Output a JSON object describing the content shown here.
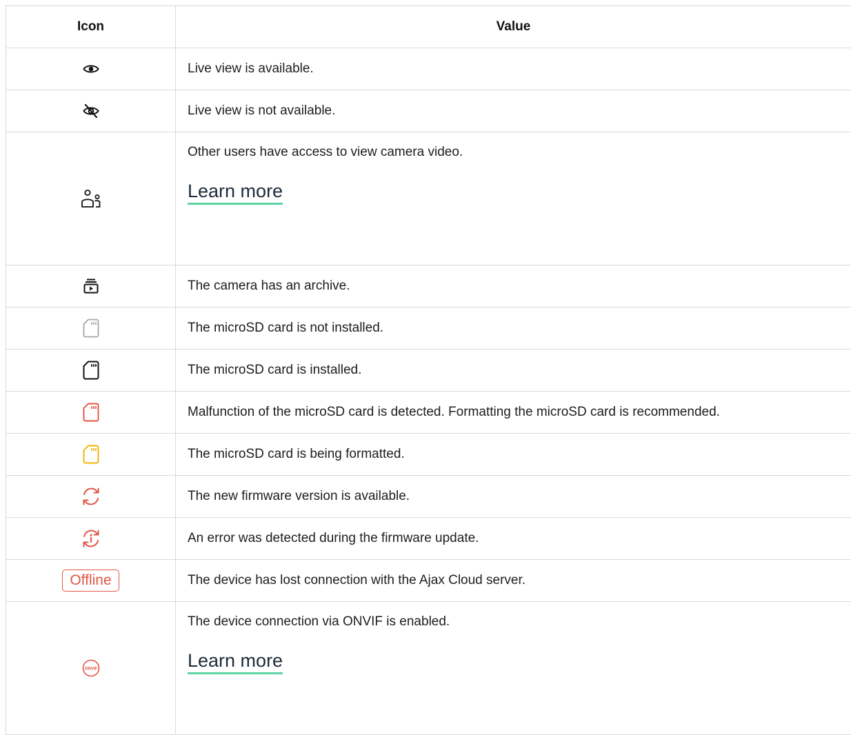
{
  "header": {
    "icon_col": "Icon",
    "value_col": "Value"
  },
  "rows": [
    {
      "icon": "eye-icon",
      "text": "Live view is available."
    },
    {
      "icon": "eye-off-icon",
      "text": "Live view is not available."
    },
    {
      "icon": "shared-users-icon",
      "text": "Other users have access to view camera video.",
      "link": "Learn more"
    },
    {
      "icon": "archive-icon",
      "text": "The camera has an archive."
    },
    {
      "icon": "sd-card-grey-icon",
      "text": "The microSD card is not installed."
    },
    {
      "icon": "sd-card-black-icon",
      "text": "The microSD card is installed."
    },
    {
      "icon": "sd-card-red-icon",
      "text": "Malfunction of the microSD card is detected. Formatting the microSD card is recommended."
    },
    {
      "icon": "sd-card-yellow-icon",
      "text": "The microSD card is being formatted."
    },
    {
      "icon": "firmware-update-icon",
      "text": "The new firmware version is available."
    },
    {
      "icon": "firmware-error-icon",
      "text": "An error was detected during the firmware update."
    },
    {
      "icon": "offline-badge",
      "badge": "Offline",
      "text": "The device has lost connection with the Ajax Cloud server."
    },
    {
      "icon": "onvif-icon",
      "icon_text": "ONVIF",
      "text": "The device connection via ONVIF is enabled.",
      "link": "Learn more"
    }
  ],
  "colors": {
    "red": "#e05545",
    "yellow": "#f0b400",
    "grey": "#a6a6a6",
    "link_underline": "#5bd3a3"
  }
}
